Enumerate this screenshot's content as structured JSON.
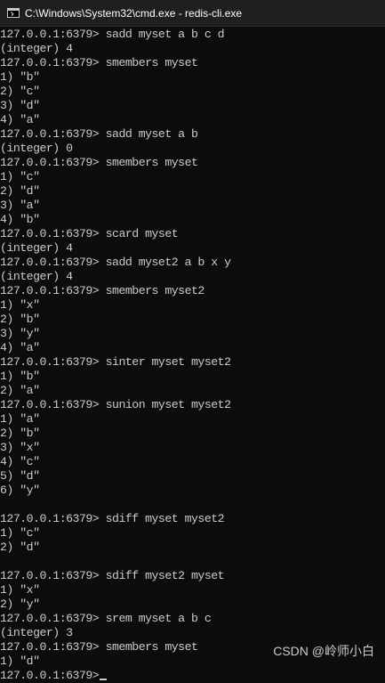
{
  "window": {
    "title": "C:\\Windows\\System32\\cmd.exe - redis-cli.exe"
  },
  "terminal": {
    "lines": [
      "127.0.0.1:6379> sadd myset a b c d",
      "(integer) 4",
      "127.0.0.1:6379> smembers myset",
      "1) \"b\"",
      "2) \"c\"",
      "3) \"d\"",
      "4) \"a\"",
      "127.0.0.1:6379> sadd myset a b",
      "(integer) 0",
      "127.0.0.1:6379> smembers myset",
      "1) \"c\"",
      "2) \"d\"",
      "3) \"a\"",
      "4) \"b\"",
      "127.0.0.1:6379> scard myset",
      "(integer) 4",
      "127.0.0.1:6379> sadd myset2 a b x y",
      "(integer) 4",
      "127.0.0.1:6379> smembers myset2",
      "1) \"x\"",
      "2) \"b\"",
      "3) \"y\"",
      "4) \"a\"",
      "127.0.0.1:6379> sinter myset myset2",
      "1) \"b\"",
      "2) \"a\"",
      "127.0.0.1:6379> sunion myset myset2",
      "1) \"a\"",
      "2) \"b\"",
      "3) \"x\"",
      "4) \"c\"",
      "5) \"d\"",
      "6) \"y\"",
      "",
      "127.0.0.1:6379> sdiff myset myset2",
      "1) \"c\"",
      "2) \"d\"",
      "",
      "127.0.0.1:6379> sdiff myset2 myset",
      "1) \"x\"",
      "2) \"y\"",
      "127.0.0.1:6379> srem myset a b c",
      "(integer) 3",
      "127.0.0.1:6379> smembers myset",
      "1) \"d\"",
      "127.0.0.1:6379>"
    ]
  },
  "watermark": {
    "text": "CSDN @岭师小白"
  }
}
